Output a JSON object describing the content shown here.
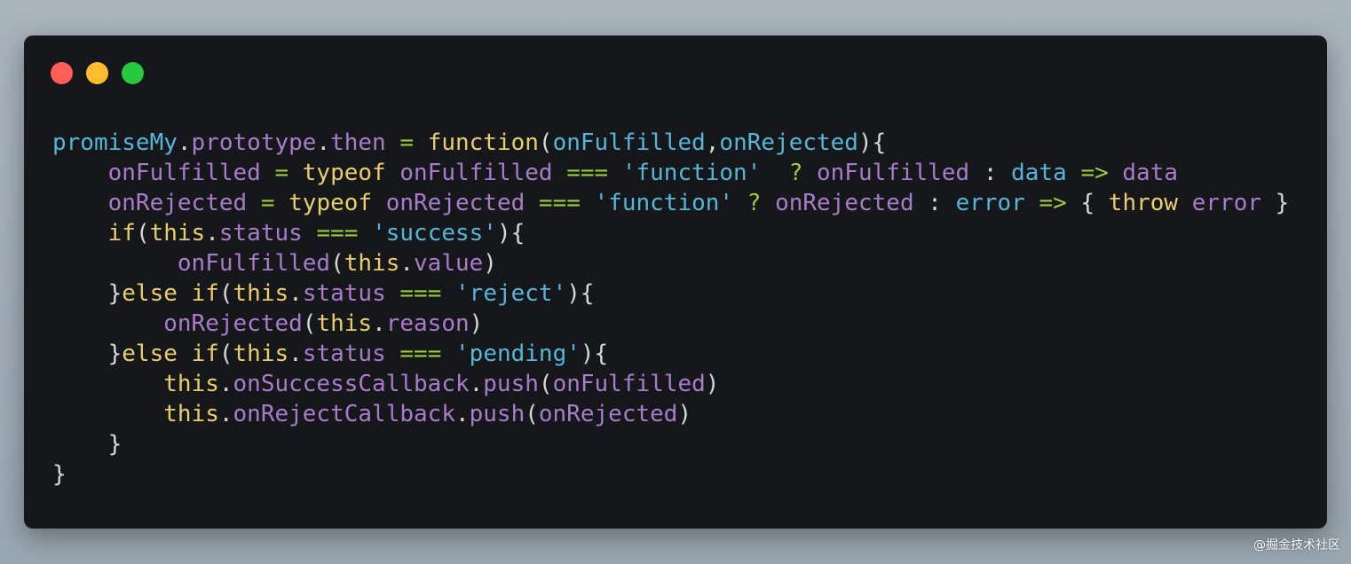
{
  "window": {
    "controls": [
      {
        "name": "close",
        "color": "#ff5f56"
      },
      {
        "name": "minimize",
        "color": "#ffbd2e"
      },
      {
        "name": "maximize",
        "color": "#27c93f"
      }
    ]
  },
  "code": {
    "language": "javascript",
    "lines": [
      [
        [
          "promiseMy",
          "blue"
        ],
        [
          ".",
          "plain"
        ],
        [
          "prototype",
          "purple"
        ],
        [
          ".",
          "plain"
        ],
        [
          "then",
          "purple"
        ],
        [
          " ",
          "plain"
        ],
        [
          "=",
          "green"
        ],
        [
          " ",
          "plain"
        ],
        [
          "function",
          "yellow"
        ],
        [
          "(",
          "plain"
        ],
        [
          "onFulfilled",
          "blue"
        ],
        [
          ",",
          "plain"
        ],
        [
          "onRejected",
          "blue"
        ],
        [
          "){",
          "plain"
        ]
      ],
      [
        [
          "    ",
          "plain"
        ],
        [
          "onFulfilled",
          "purple"
        ],
        [
          " ",
          "plain"
        ],
        [
          "=",
          "green"
        ],
        [
          " ",
          "plain"
        ],
        [
          "typeof",
          "yellow"
        ],
        [
          " ",
          "plain"
        ],
        [
          "onFulfilled",
          "purple"
        ],
        [
          " ",
          "plain"
        ],
        [
          "===",
          "green"
        ],
        [
          " ",
          "plain"
        ],
        [
          "'function'",
          "blue"
        ],
        [
          "  ",
          "plain"
        ],
        [
          "?",
          "green"
        ],
        [
          " ",
          "plain"
        ],
        [
          "onFulfilled",
          "purple"
        ],
        [
          " : ",
          "plain"
        ],
        [
          "data",
          "blue"
        ],
        [
          " ",
          "plain"
        ],
        [
          "=>",
          "green"
        ],
        [
          " ",
          "plain"
        ],
        [
          "data",
          "purple"
        ]
      ],
      [
        [
          "    ",
          "plain"
        ],
        [
          "onRejected",
          "purple"
        ],
        [
          " ",
          "plain"
        ],
        [
          "=",
          "green"
        ],
        [
          " ",
          "plain"
        ],
        [
          "typeof",
          "yellow"
        ],
        [
          " ",
          "plain"
        ],
        [
          "onRejected",
          "purple"
        ],
        [
          " ",
          "plain"
        ],
        [
          "===",
          "green"
        ],
        [
          " ",
          "plain"
        ],
        [
          "'function'",
          "blue"
        ],
        [
          " ",
          "plain"
        ],
        [
          "?",
          "green"
        ],
        [
          " ",
          "plain"
        ],
        [
          "onRejected",
          "purple"
        ],
        [
          " : ",
          "plain"
        ],
        [
          "error",
          "blue"
        ],
        [
          " ",
          "plain"
        ],
        [
          "=>",
          "green"
        ],
        [
          " { ",
          "plain"
        ],
        [
          "throw",
          "yellow"
        ],
        [
          " ",
          "plain"
        ],
        [
          "error",
          "purple"
        ],
        [
          " }",
          "plain"
        ]
      ],
      [
        [
          "    ",
          "plain"
        ],
        [
          "if",
          "yellow"
        ],
        [
          "(",
          "plain"
        ],
        [
          "this",
          "yellow"
        ],
        [
          ".",
          "plain"
        ],
        [
          "status",
          "purple"
        ],
        [
          " ",
          "plain"
        ],
        [
          "===",
          "green"
        ],
        [
          " ",
          "plain"
        ],
        [
          "'success'",
          "blue"
        ],
        [
          "){",
          "plain"
        ]
      ],
      [
        [
          "         ",
          "plain"
        ],
        [
          "onFulfilled",
          "purple"
        ],
        [
          "(",
          "plain"
        ],
        [
          "this",
          "yellow"
        ],
        [
          ".",
          "plain"
        ],
        [
          "value",
          "purple"
        ],
        [
          ")",
          "plain"
        ]
      ],
      [
        [
          "    ",
          "plain"
        ],
        [
          "}",
          "plain"
        ],
        [
          "else",
          "yellow"
        ],
        [
          " ",
          "plain"
        ],
        [
          "if",
          "yellow"
        ],
        [
          "(",
          "plain"
        ],
        [
          "this",
          "yellow"
        ],
        [
          ".",
          "plain"
        ],
        [
          "status",
          "purple"
        ],
        [
          " ",
          "plain"
        ],
        [
          "===",
          "green"
        ],
        [
          " ",
          "plain"
        ],
        [
          "'reject'",
          "blue"
        ],
        [
          "){",
          "plain"
        ]
      ],
      [
        [
          "        ",
          "plain"
        ],
        [
          "onRejected",
          "purple"
        ],
        [
          "(",
          "plain"
        ],
        [
          "this",
          "yellow"
        ],
        [
          ".",
          "plain"
        ],
        [
          "reason",
          "purple"
        ],
        [
          ")",
          "plain"
        ]
      ],
      [
        [
          "    ",
          "plain"
        ],
        [
          "}",
          "plain"
        ],
        [
          "else",
          "yellow"
        ],
        [
          " ",
          "plain"
        ],
        [
          "if",
          "yellow"
        ],
        [
          "(",
          "plain"
        ],
        [
          "this",
          "yellow"
        ],
        [
          ".",
          "plain"
        ],
        [
          "status",
          "purple"
        ],
        [
          " ",
          "plain"
        ],
        [
          "===",
          "green"
        ],
        [
          " ",
          "plain"
        ],
        [
          "'pending'",
          "blue"
        ],
        [
          "){",
          "plain"
        ]
      ],
      [
        [
          "        ",
          "plain"
        ],
        [
          "this",
          "yellow"
        ],
        [
          ".",
          "plain"
        ],
        [
          "onSuccessCallback",
          "purple"
        ],
        [
          ".",
          "plain"
        ],
        [
          "push",
          "purple"
        ],
        [
          "(",
          "plain"
        ],
        [
          "onFulfilled",
          "purple"
        ],
        [
          ")",
          "plain"
        ]
      ],
      [
        [
          "        ",
          "plain"
        ],
        [
          "this",
          "yellow"
        ],
        [
          ".",
          "plain"
        ],
        [
          "onRejectCallback",
          "purple"
        ],
        [
          ".",
          "plain"
        ],
        [
          "push",
          "purple"
        ],
        [
          "(",
          "plain"
        ],
        [
          "onRejected",
          "purple"
        ],
        [
          ")",
          "plain"
        ]
      ],
      [
        [
          "    ",
          "plain"
        ],
        [
          "}",
          "plain"
        ]
      ],
      [
        [
          "}",
          "plain"
        ]
      ]
    ]
  },
  "watermark": "@掘金技术社区"
}
